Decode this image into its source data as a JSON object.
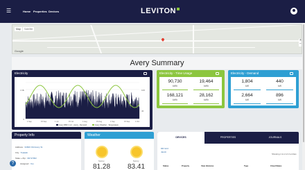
{
  "nav": {
    "items": [
      "Home",
      "Properties",
      "Devices"
    ],
    "logo": "LEVITON"
  },
  "map": {
    "tabs": [
      "Map",
      "Satellite"
    ],
    "zoom_in": "+",
    "zoom_out": "−",
    "attribution": "Google"
  },
  "page": {
    "title": "Avery Summary"
  },
  "electricity": {
    "title": "Electricity",
    "legend": [
      "Avery RB3 1 & 2 - Avery - Demand",
      "Avery Weather - Temperature"
    ],
    "colors": {
      "demand": "#1b1e45",
      "temperature": "#8cc63f"
    },
    "x_ticks": [
      "1 Sep",
      "15 Sep",
      "1 Jul",
      "15 Jul",
      "1 Aug",
      "15 Aug",
      "1 Sep",
      "15 Sep",
      "1 Oct"
    ],
    "left_ticks": [
      "2.0k",
      "1.5k",
      "1.0k",
      "500",
      "0"
    ],
    "right_ticks": [
      "100",
      "80",
      "60",
      "40"
    ]
  },
  "tou": {
    "title": "Electricity - Time Usage",
    "cells": [
      {
        "value": "90,730",
        "unit": "kWh"
      },
      {
        "value": "19,464",
        "unit": "kWh"
      },
      {
        "value": "168,121",
        "unit": "kWh"
      },
      {
        "value": "28,162",
        "unit": "kWh"
      }
    ]
  },
  "demand": {
    "title": "Electricity - Demand",
    "cells": [
      {
        "value": "1,804",
        "unit": "kW"
      },
      {
        "value": "440",
        "unit": "kW"
      },
      {
        "value": "2,664",
        "unit": "kW"
      },
      {
        "value": "896",
        "unit": "kW"
      }
    ]
  },
  "property": {
    "title": "Property Info",
    "rows": [
      {
        "label": "Address : ",
        "value": "34600 Old Avery St"
      },
      {
        "label": "City : ",
        "value": "Tualatin"
      },
      {
        "label": "State + Zip : ",
        "value": "OR 97062"
      },
      {
        "label": "Assigned : ",
        "value": "Yes"
      }
    ]
  },
  "weather": {
    "title": "Weather",
    "temps": [
      "81.28",
      "83.41"
    ],
    "labels": [
      "Sunny",
      "Sunny"
    ]
  },
  "devices": {
    "tabs": [
      "DEVICES",
      "PROPERTIES",
      "JOURNALS"
    ],
    "links": [
      "DR Grid",
      "Jacob"
    ],
    "showing": "Showing 1 to 2 of 2 entries",
    "columns": [
      "Status",
      "Property",
      "View Histories",
      "Type",
      "Cloud States"
    ]
  }
}
